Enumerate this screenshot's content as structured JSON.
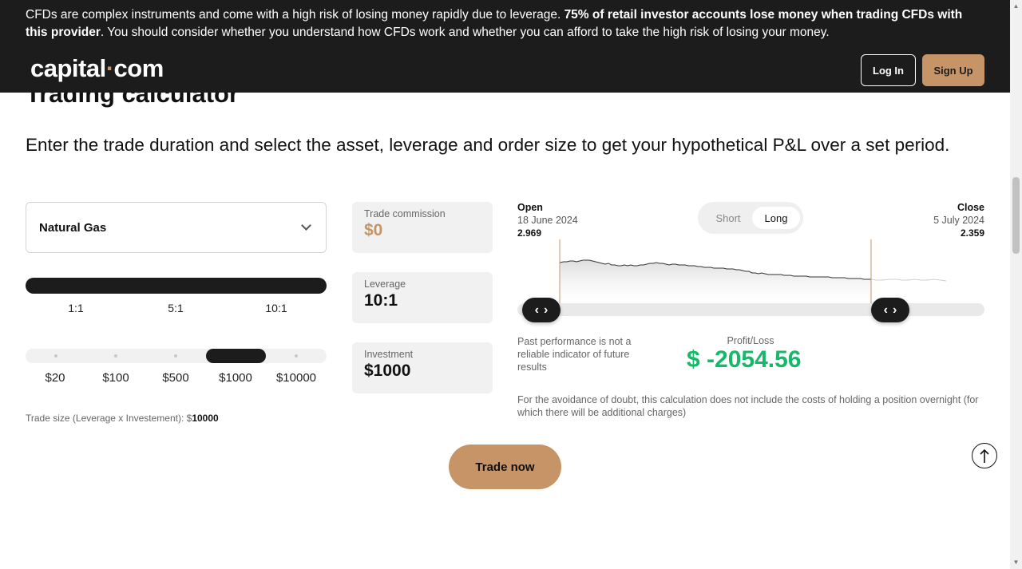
{
  "banner": {
    "risk_part1": "CFDs are complex instruments and come with a high risk of losing money rapidly due to leverage. ",
    "risk_bold": "75% of retail investor accounts lose money when trading CFDs with this provider",
    "risk_part2": ". You should consider whether you understand how CFDs work and whether you can afford to take the high risk of losing your money."
  },
  "header": {
    "logo_left": "capital",
    "logo_dot": "·",
    "logo_right": "com",
    "login_label": "Log In",
    "signup_label": "Sign Up"
  },
  "calculator": {
    "title": "Trading calculator",
    "subtitle": "Enter the trade duration and select the asset, leverage and order size to get your hypothetical P&L over a set period.",
    "asset": "Natural Gas",
    "leverage_options": [
      "1:1",
      "5:1",
      "10:1"
    ],
    "leverage_selected": "10:1",
    "investment_options": [
      "$20",
      "$100",
      "$500",
      "$1000",
      "$10000"
    ],
    "investment_selected": "$1000",
    "trade_size_label": "Trade size (Leverage x Investement): $",
    "trade_size_value": "10000",
    "commission_caption": "Trade commission",
    "commission_value": "$0",
    "leverage_caption": "Leverage",
    "leverage_value": "10:1",
    "investment_caption": "Investment",
    "investment_value": "$1000"
  },
  "chart": {
    "open_label": "Open",
    "open_date": "18 June 2024",
    "open_value": "2.969",
    "close_label": "Close",
    "close_date": "5 July 2024",
    "close_value": "2.359",
    "toggle_short": "Short",
    "toggle_long": "Long",
    "toggle_selected": "Long",
    "handle_glyph": "‹ ›",
    "range_start_fraction": 0.09,
    "range_end_fraction": 0.75
  },
  "results": {
    "past_performance": "Past performance is not a reliable indicator of future results",
    "pl_caption": "Profit/Loss",
    "pl_value": "$ -2054.56",
    "disclaimer": "For the avoidance of doubt, this calculation does not include the costs of holding a position overnight (for which there will be additional charges)",
    "trade_now_label": "Trade now"
  },
  "colors": {
    "accent": "#c69466",
    "dark": "#1c1c1c",
    "profit_green": "#16b86a"
  },
  "icons": {
    "dropdown": "chevron-down-icon",
    "back_to_top": "arrow-up-icon"
  }
}
